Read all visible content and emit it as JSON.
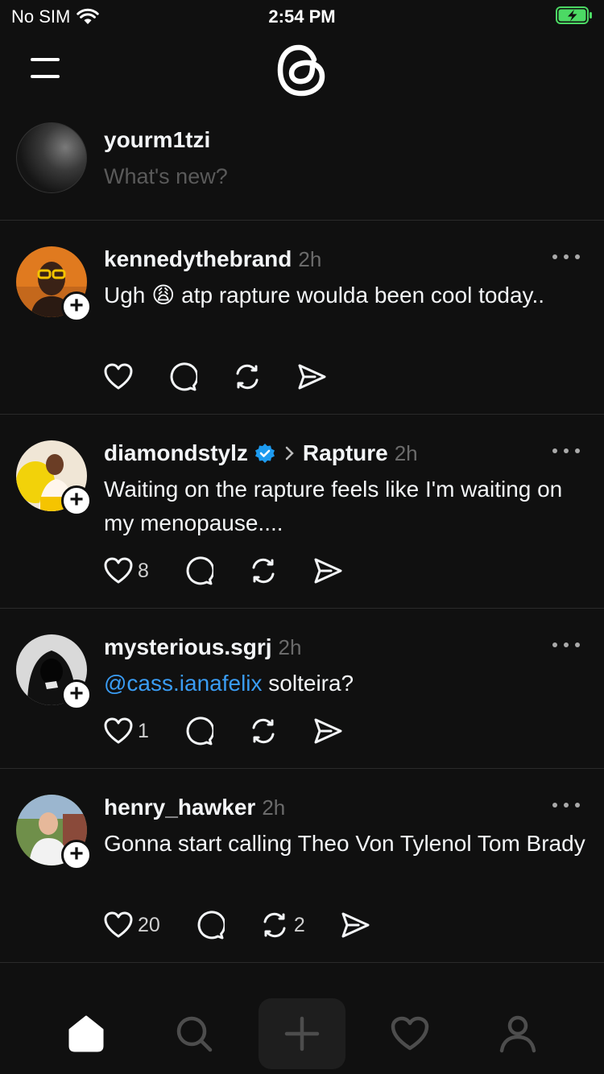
{
  "status_bar": {
    "carrier": "No SIM",
    "time": "2:54 PM"
  },
  "composer": {
    "username": "yourm1tzi",
    "placeholder": "What's new?"
  },
  "posts": [
    {
      "username": "kennedythebrand",
      "time": "2h",
      "verified": false,
      "topic": "",
      "text_before": "Ugh",
      "emoji": "😩",
      "text_after": "atp rapture woulda been cool today..",
      "likes": "",
      "reposts": ""
    },
    {
      "username": "diamondstylz",
      "time": "2h",
      "verified": true,
      "topic": "Rapture",
      "text": "Waiting on the rapture feels like I'm waiting on my menopause....",
      "likes": "8",
      "reposts": ""
    },
    {
      "username": "mysterious.sgrj",
      "time": "2h",
      "verified": false,
      "topic": "",
      "mention": "@cass.ianafelix",
      "text": "solteira?",
      "likes": "1",
      "reposts": ""
    },
    {
      "username": "henry_hawker",
      "time": "2h",
      "verified": false,
      "topic": "",
      "text": "Gonna start calling Theo Von Tylenol Tom Brady",
      "likes": "20",
      "reposts": "2"
    }
  ],
  "colors": {
    "background": "#101010",
    "text": "#f3f5f7",
    "secondary": "#6b6b6b",
    "link": "#3a9cf3",
    "verified": "#1d9bf0",
    "battery": "#4cd964"
  },
  "icons": {
    "nav": [
      "home-icon",
      "search-icon",
      "create-icon",
      "activity-heart-icon",
      "profile-icon"
    ]
  }
}
